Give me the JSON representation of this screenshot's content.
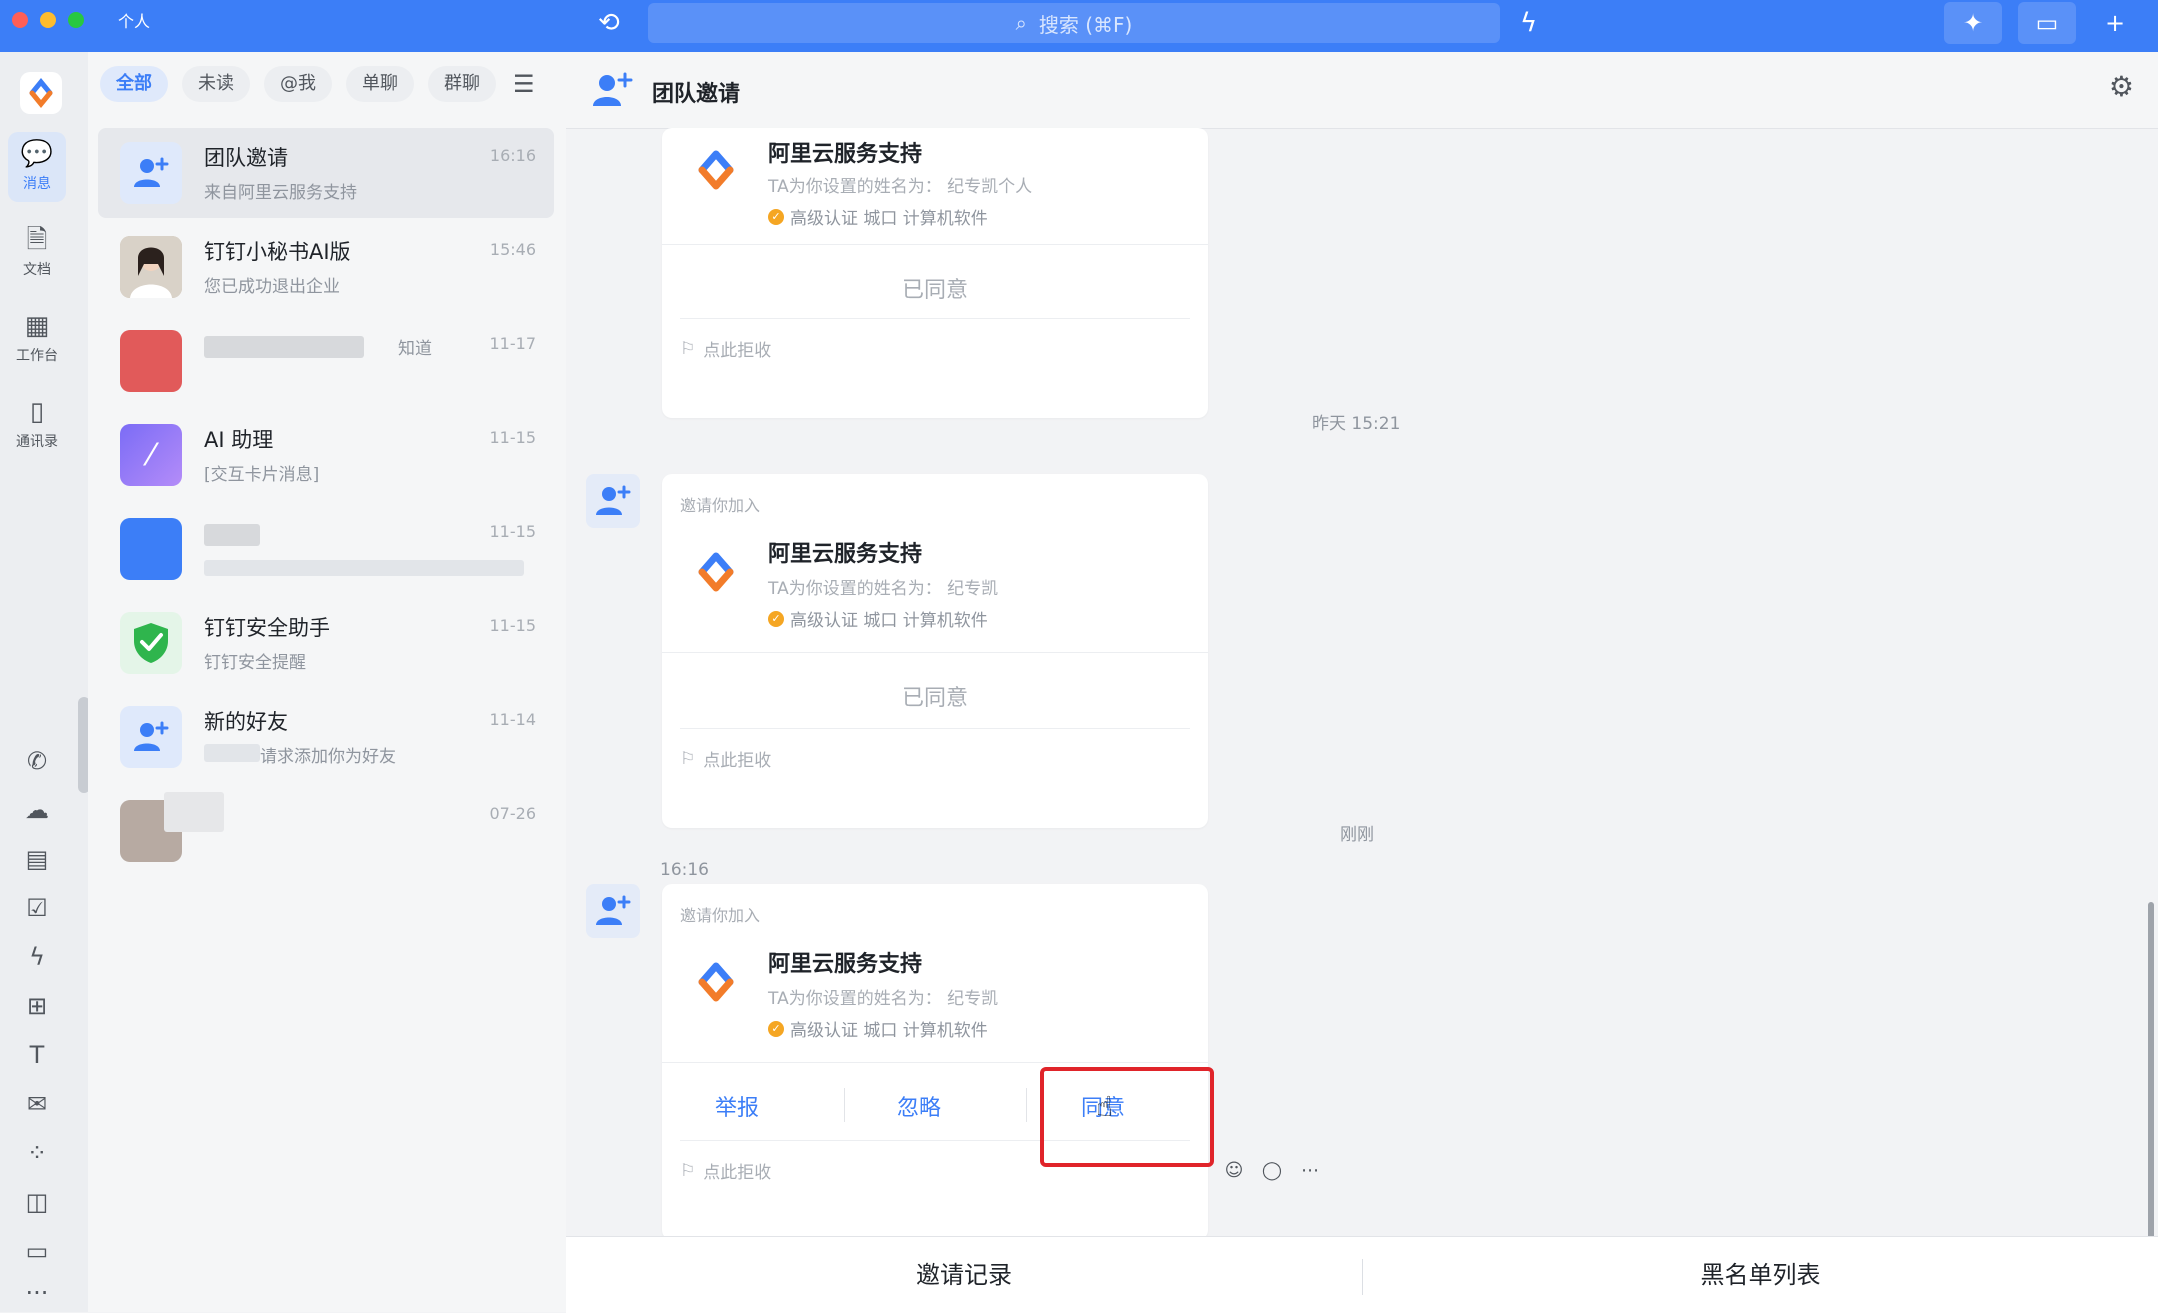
{
  "titlebar": {
    "user_chip": "个人",
    "search_placeholder": "搜索 (⌘F)"
  },
  "rail": {
    "items": [
      {
        "label": "消息",
        "icon": "message-icon"
      },
      {
        "label": "文档",
        "icon": "document-icon"
      },
      {
        "label": "工作台",
        "icon": "workbench-icon"
      },
      {
        "label": "通讯录",
        "icon": "contacts-icon"
      }
    ],
    "more": "···"
  },
  "filters": [
    "全部",
    "未读",
    "@我",
    "单聊",
    "群聊"
  ],
  "conversations": [
    {
      "name": "团队邀请",
      "sub": "来自阿里云服务支持",
      "time": "16:16"
    },
    {
      "name": "钉钉小秘书AI版",
      "sub": "您已成功退出企业",
      "time": "15:46"
    },
    {
      "name": "",
      "sub": "知道",
      "time": "11-17"
    },
    {
      "name": "AI 助理",
      "sub": "[交互卡片消息]",
      "time": "11-15"
    },
    {
      "name": "",
      "sub": "",
      "time": "11-15"
    },
    {
      "name": "钉钉安全助手",
      "sub": "钉钉安全提醒",
      "time": "11-15"
    },
    {
      "name": "新的好友",
      "sub": "请求添加你为好友",
      "time": "11-14"
    },
    {
      "name": "",
      "sub": "",
      "time": "07-26"
    }
  ],
  "chat": {
    "title": "团队邀请",
    "cards": [
      {
        "invite": "",
        "org": "阿里云服务支持",
        "alias": "TA为你设置的姓名为： 纪专凯个人",
        "cert": "高级认证 城口 计算机软件",
        "status": "已同意",
        "reject": "点此拒收"
      },
      {
        "invite": "邀请你加入",
        "org": "阿里云服务支持",
        "alias": "TA为你设置的姓名为： 纪专凯",
        "cert": "高级认证 城口 计算机软件",
        "status": "已同意",
        "reject": "点此拒收"
      },
      {
        "invite": "邀请你加入",
        "org": "阿里云服务支持",
        "alias": "TA为你设置的姓名为： 纪专凯",
        "cert": "高级认证 城口 计算机软件",
        "actions": [
          "举报",
          "忽略",
          "同意"
        ],
        "reject": "点此拒收"
      }
    ],
    "time_yesterday": "昨天 15:21",
    "time_now": "刚刚",
    "msg_time": "16:16"
  },
  "footer": {
    "invite_records": "邀请记录",
    "blacklist": "黑名单列表"
  },
  "colors": {
    "accent": "#3c7ef7",
    "highlight": "#e0242a"
  }
}
